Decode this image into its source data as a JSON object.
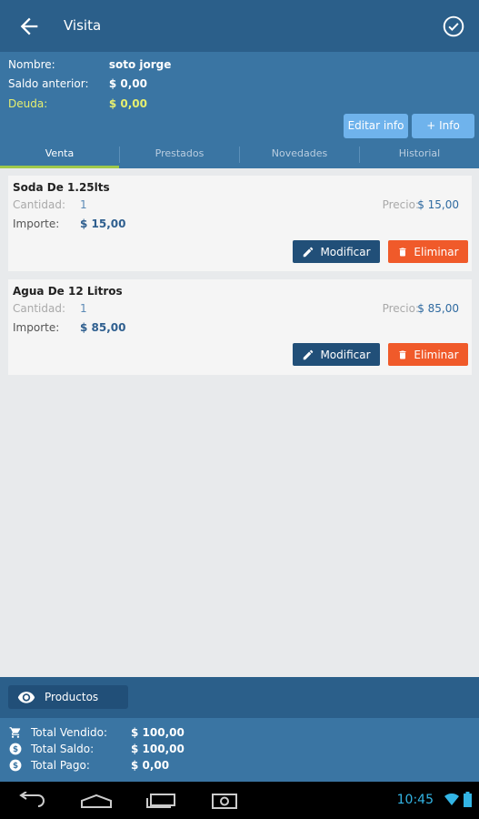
{
  "appbar": {
    "title": "Visita",
    "back_icon": "arrow-left-icon",
    "confirm_icon": "check-circle-icon"
  },
  "client": {
    "nombre_label": "Nombre:",
    "nombre_value": "soto jorge",
    "saldo_label": "Saldo anterior:",
    "saldo_value": "$ 0,00",
    "deuda_label": "Deuda:",
    "deuda_value": "$ 0,00",
    "deuda_color": "#e6ef6f"
  },
  "actions": {
    "edit_info": "Editar info",
    "add_info": "+ Info"
  },
  "tabs": [
    {
      "label": "Venta",
      "active": true
    },
    {
      "label": "Prestados",
      "active": false
    },
    {
      "label": "Novedades",
      "active": false
    },
    {
      "label": "Historial",
      "active": false
    }
  ],
  "items": [
    {
      "name": "Soda De 1.25lts",
      "cantidad_label": "Cantidad:",
      "cantidad": "1",
      "importe_label": "Importe:",
      "importe": "$ 15,00",
      "precio_label": "Precio:",
      "precio": "$ 15,00",
      "modify": "Modificar",
      "delete": "Eliminar"
    },
    {
      "name": "Agua De 12 Litros",
      "cantidad_label": "Cantidad:",
      "cantidad": "1",
      "importe_label": "Importe:",
      "importe": "$ 85,00",
      "precio_label": "Precio:",
      "precio": "$ 85,00",
      "modify": "Modificar",
      "delete": "Eliminar"
    }
  ],
  "products_button": "Productos",
  "totals": [
    {
      "icon": "cart-icon",
      "label": "Total Vendido:",
      "value": "$ 100,00"
    },
    {
      "icon": "dollar-icon",
      "label": "Total Saldo:",
      "value": "$ 100,00"
    },
    {
      "icon": "dollar-icon",
      "label": "Total Pago:",
      "value": "$ 0,00"
    }
  ],
  "system": {
    "time": "10:45"
  },
  "colors": {
    "primary": "#2b5f8a",
    "secondary": "#3a75a3",
    "accent_tab": "#9ec84b",
    "delete": "#f05a2a",
    "modify": "#214f78"
  }
}
